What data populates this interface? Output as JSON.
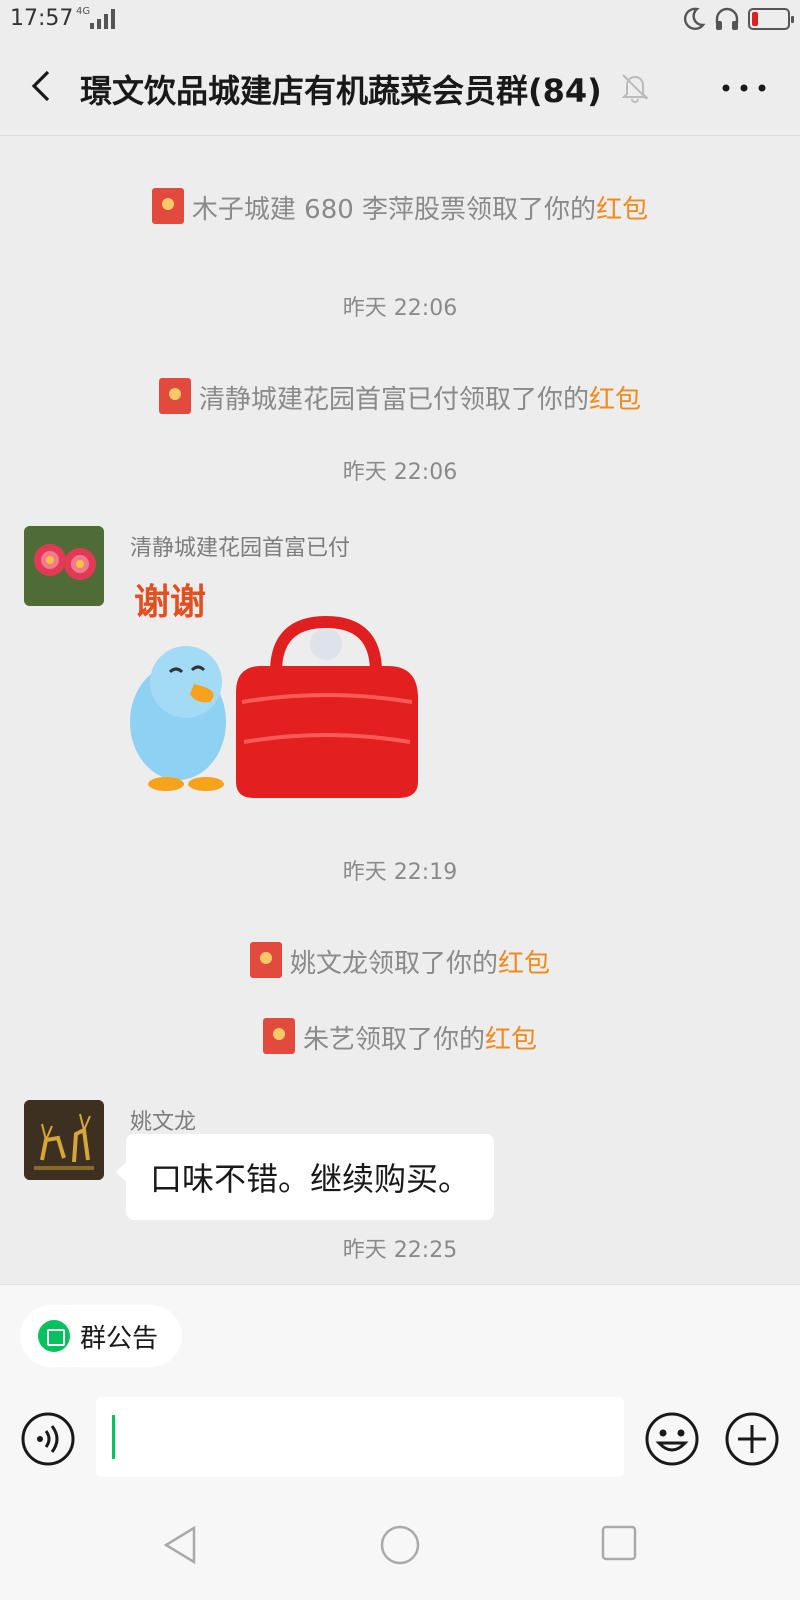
{
  "status_bar": {
    "time": "17:57",
    "network": "4G"
  },
  "header": {
    "title": "璟文饮品城建店有机蔬菜会员群(84)"
  },
  "messages": [
    {
      "type": "system",
      "text": "木子城建 680 李萍股票领取了你的",
      "link": "红包"
    },
    {
      "type": "timestamp",
      "text": "昨天 22:06"
    },
    {
      "type": "system",
      "text": "清静城建花园首富已付领取了你的",
      "link": "红包"
    },
    {
      "type": "timestamp",
      "text": "昨天 22:06"
    },
    {
      "type": "sticker",
      "sender": "清静城建花园首富已付",
      "sticker_text": "谢谢"
    },
    {
      "type": "timestamp",
      "text": "昨天 22:19"
    },
    {
      "type": "system",
      "text": "姚文龙领取了你的",
      "link": "红包"
    },
    {
      "type": "system",
      "text": "朱艺领取了你的",
      "link": "红包"
    },
    {
      "type": "text",
      "sender": "姚文龙",
      "text": "口味不错。继续购买。"
    },
    {
      "type": "timestamp",
      "text": "昨天 22:25"
    }
  ],
  "composer": {
    "notice_label": "群公告",
    "input_value": ""
  },
  "colors": {
    "accent_green": "#07c160",
    "link_orange": "#f08a1c",
    "red_packet": "#e24a3d"
  }
}
